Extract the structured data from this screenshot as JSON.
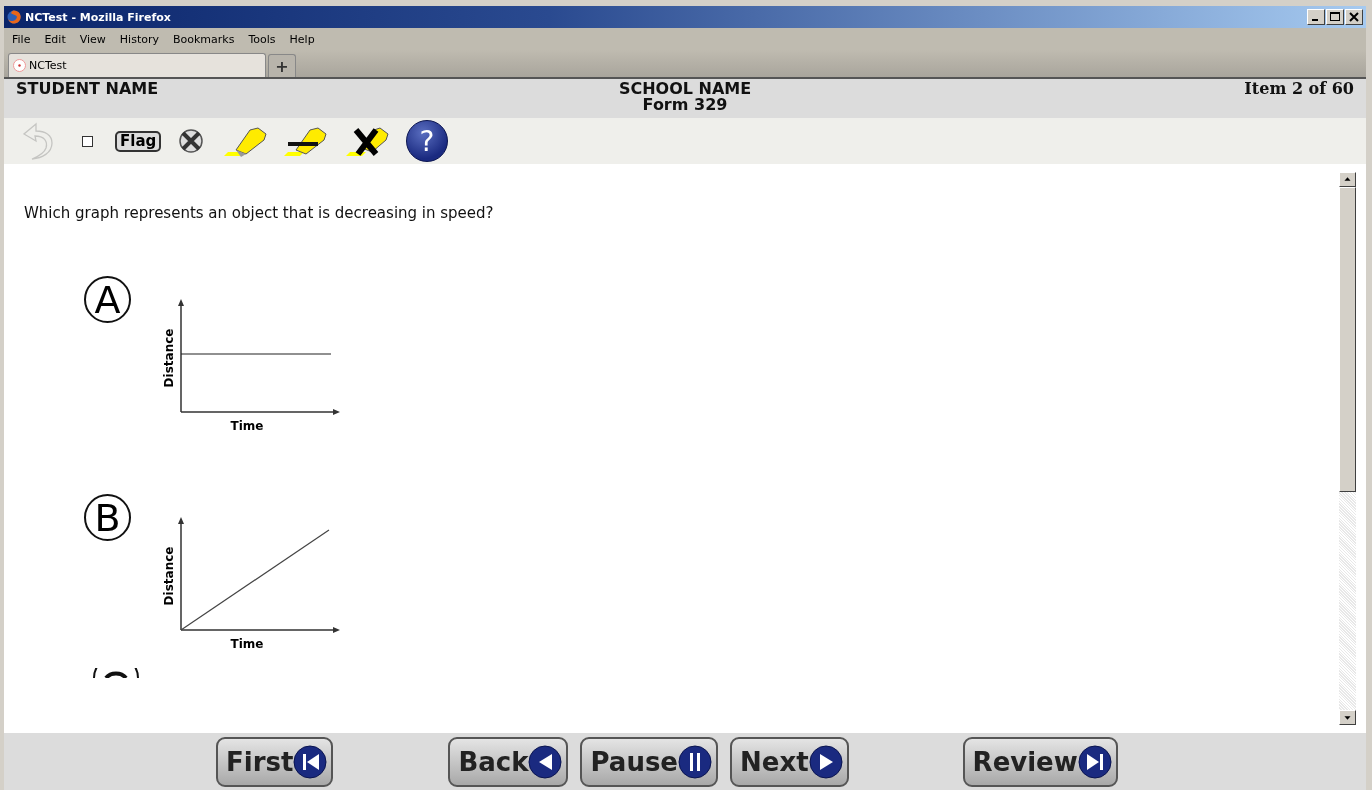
{
  "window": {
    "title": "NCTest - Mozilla Firefox"
  },
  "menu": [
    "File",
    "Edit",
    "View",
    "History",
    "Bookmarks",
    "Tools",
    "Help"
  ],
  "tabs": [
    {
      "label": "NCTest",
      "selected": true
    }
  ],
  "new_tab": "+",
  "header": {
    "student": "STUDENT NAME",
    "school": "SCHOOL NAME",
    "form": "Form 329",
    "item": "Item 2 of 60"
  },
  "toolbar": {
    "back_disabled": true,
    "mark_checked": false,
    "flag": "Flag",
    "help": "?"
  },
  "question": "Which graph represents an object that is decreasing in speed?",
  "options": [
    {
      "letter": "A",
      "graph": {
        "kind": "constant",
        "ylabel": "Distance",
        "xlabel": "Time"
      }
    },
    {
      "letter": "B",
      "graph": {
        "kind": "linear",
        "ylabel": "Distance",
        "xlabel": "Time"
      }
    }
  ],
  "footer": [
    {
      "label": "First",
      "kind": "first"
    },
    {
      "label": "Back",
      "kind": "back"
    },
    {
      "label": "Pause",
      "kind": "pause"
    },
    {
      "label": "Next",
      "kind": "next"
    },
    {
      "label": "Review",
      "kind": "review"
    }
  ]
}
